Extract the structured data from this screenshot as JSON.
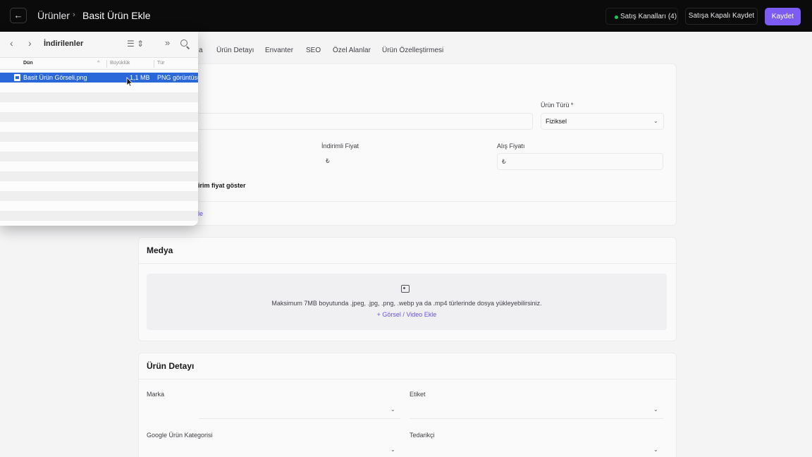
{
  "header": {
    "back_icon": "←",
    "breadcrumb_parent": "Ürünler",
    "breadcrumb_separator": "›",
    "page_title": "Basit Ürün Ekle",
    "channels_label": "Satış Kanalları (4)",
    "channels_status_color": "#22c55e",
    "save_closed_label": "Satışa Kapalı Kaydet",
    "save_label": "Kaydet",
    "accent_color": "#7c5cf2"
  },
  "tabs": {
    "partial_first": "a",
    "items": [
      "Ürün Detayı",
      "Envanter",
      "SEO",
      "Özel Alanlar",
      "Ürün Özelleştirmesi"
    ]
  },
  "general": {
    "product_type_label": "Ürün Türü",
    "required_mark": "*",
    "product_type_value": "Fiziksel",
    "discounted_price_label": "İndirimli Fiyat",
    "purchase_price_label": "Alış Fiyatı",
    "currency_symbol": "₺",
    "show_discount_partial": "irim fiyat göster",
    "partial_link": "le"
  },
  "media": {
    "title": "Medya",
    "icon": "image-icon",
    "help_text": "Maksimum 7MB boyutunda .jpeg, .jpg, .png, .webp ya da .mp4 türlerinde dosya yükleyebilirsiniz.",
    "add_label": "+ Görsel / Video Ekle"
  },
  "product_detail": {
    "title": "Ürün Detayı",
    "brand_label": "Marka",
    "tag_label": "Etiket",
    "google_category_label": "Google Ürün Kategorisi",
    "supplier_label": "Tedarikçi"
  },
  "finder": {
    "title": "İndirilenler",
    "columns": {
      "name": "Dün",
      "size": "Büyüklük",
      "kind": "Tür"
    },
    "selected_row": {
      "name": "Basit Ürün Görseli.png",
      "size": "1,1 MB",
      "kind": "PNG görüntüsü"
    },
    "selection_color": "#2a67d8"
  }
}
